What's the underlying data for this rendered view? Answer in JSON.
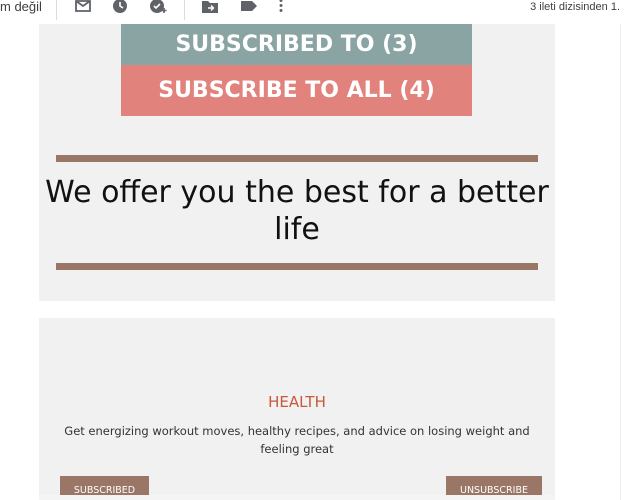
{
  "toolbar": {
    "left_text": "m değil",
    "thread_count": "3 ileti dizisinden 1.",
    "icons": [
      "mark-unread-icon",
      "snooze-icon",
      "add-task-icon",
      "move-to-icon",
      "label-icon",
      "more-icon"
    ]
  },
  "header_buttons": {
    "subscribed_to": "SUBSCRIBED TO (3)",
    "subscribe_to_all": "SUBSCRIBE TO ALL (4)"
  },
  "headline": "We offer you the best for a better life",
  "health": {
    "title": "HEALTH",
    "description": "Get energizing workout moves, healthy recipes, and advice on losing weight and feeling great",
    "subscribed_label": "SUBSCRIBED",
    "unsubscribe_label": "UNSUBSCRIBE"
  },
  "colors": {
    "subscribed_to_bg": "#8aa3a3",
    "subscribe_all_bg": "#e2827c",
    "accent_brown": "#9a7667",
    "health_title": "#c8583a",
    "card_bg": "#f1f1f1"
  }
}
